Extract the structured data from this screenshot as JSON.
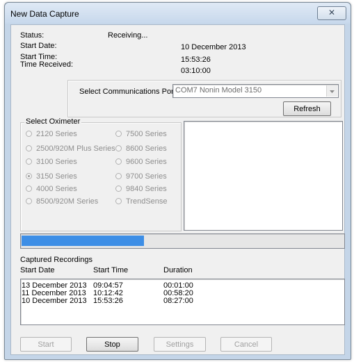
{
  "window": {
    "title": "New Data Capture",
    "close_glyph": "✕"
  },
  "status": {
    "status_label": "Status:",
    "status_value": "Receiving...",
    "start_date_label": "Start Date:",
    "start_date_value": "10 December 2013",
    "start_time_label": "Start Time:",
    "start_time_value": "15:53:26",
    "time_received_label": "Time Received:",
    "time_received_value": "03:10:00"
  },
  "port": {
    "label": "Select Communications Port",
    "selected": "COM7  Nonin Model 3150",
    "refresh_label": "Refresh"
  },
  "oximeter": {
    "group_label": "Select Oximeter",
    "left": [
      {
        "label": "2120 Series",
        "checked": false
      },
      {
        "label": "2500/920M Plus Series",
        "checked": false
      },
      {
        "label": "3100 Series",
        "checked": false
      },
      {
        "label": "3150 Series",
        "checked": true
      },
      {
        "label": "4000 Series",
        "checked": false
      },
      {
        "label": "8500/920M Series",
        "checked": false
      }
    ],
    "right": [
      {
        "label": "7500 Series",
        "checked": false
      },
      {
        "label": "8600 Series",
        "checked": false
      },
      {
        "label": "9600 Series",
        "checked": false
      },
      {
        "label": "9700 Series",
        "checked": false
      },
      {
        "label": "9840 Series",
        "checked": false
      },
      {
        "label": "TrendSense",
        "checked": false
      }
    ]
  },
  "progress": {
    "fraction": 0.38,
    "color": "#3d8ee6"
  },
  "recordings": {
    "title": "Captured Recordings",
    "headers": {
      "start_date": "Start Date",
      "start_time": "Start Time",
      "duration": "Duration"
    },
    "rows": [
      {
        "date": "13 December 2013",
        "time": "09:04:57",
        "duration": "00:01:00"
      },
      {
        "date": "11 December 2013",
        "time": "10:12:42",
        "duration": "00:58:20"
      },
      {
        "date": "10 December 2013",
        "time": "15:53:26",
        "duration": "08:27:00"
      }
    ]
  },
  "buttons": {
    "start": "Start",
    "stop": "Stop",
    "settings": "Settings",
    "cancel": "Cancel"
  }
}
